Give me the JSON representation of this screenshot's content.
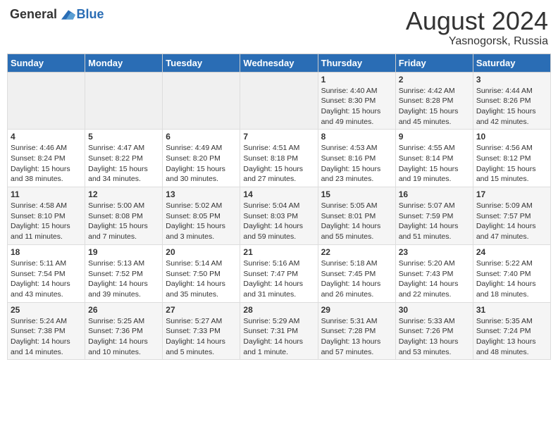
{
  "header": {
    "logo_general": "General",
    "logo_blue": "Blue",
    "month_year": "August 2024",
    "location": "Yasnogorsk, Russia"
  },
  "weekdays": [
    "Sunday",
    "Monday",
    "Tuesday",
    "Wednesday",
    "Thursday",
    "Friday",
    "Saturday"
  ],
  "weeks": [
    [
      {
        "day": "",
        "info": ""
      },
      {
        "day": "",
        "info": ""
      },
      {
        "day": "",
        "info": ""
      },
      {
        "day": "",
        "info": ""
      },
      {
        "day": "1",
        "info": "Sunrise: 4:40 AM\nSunset: 8:30 PM\nDaylight: 15 hours\nand 49 minutes."
      },
      {
        "day": "2",
        "info": "Sunrise: 4:42 AM\nSunset: 8:28 PM\nDaylight: 15 hours\nand 45 minutes."
      },
      {
        "day": "3",
        "info": "Sunrise: 4:44 AM\nSunset: 8:26 PM\nDaylight: 15 hours\nand 42 minutes."
      }
    ],
    [
      {
        "day": "4",
        "info": "Sunrise: 4:46 AM\nSunset: 8:24 PM\nDaylight: 15 hours\nand 38 minutes."
      },
      {
        "day": "5",
        "info": "Sunrise: 4:47 AM\nSunset: 8:22 PM\nDaylight: 15 hours\nand 34 minutes."
      },
      {
        "day": "6",
        "info": "Sunrise: 4:49 AM\nSunset: 8:20 PM\nDaylight: 15 hours\nand 30 minutes."
      },
      {
        "day": "7",
        "info": "Sunrise: 4:51 AM\nSunset: 8:18 PM\nDaylight: 15 hours\nand 27 minutes."
      },
      {
        "day": "8",
        "info": "Sunrise: 4:53 AM\nSunset: 8:16 PM\nDaylight: 15 hours\nand 23 minutes."
      },
      {
        "day": "9",
        "info": "Sunrise: 4:55 AM\nSunset: 8:14 PM\nDaylight: 15 hours\nand 19 minutes."
      },
      {
        "day": "10",
        "info": "Sunrise: 4:56 AM\nSunset: 8:12 PM\nDaylight: 15 hours\nand 15 minutes."
      }
    ],
    [
      {
        "day": "11",
        "info": "Sunrise: 4:58 AM\nSunset: 8:10 PM\nDaylight: 15 hours\nand 11 minutes."
      },
      {
        "day": "12",
        "info": "Sunrise: 5:00 AM\nSunset: 8:08 PM\nDaylight: 15 hours\nand 7 minutes."
      },
      {
        "day": "13",
        "info": "Sunrise: 5:02 AM\nSunset: 8:05 PM\nDaylight: 15 hours\nand 3 minutes."
      },
      {
        "day": "14",
        "info": "Sunrise: 5:04 AM\nSunset: 8:03 PM\nDaylight: 14 hours\nand 59 minutes."
      },
      {
        "day": "15",
        "info": "Sunrise: 5:05 AM\nSunset: 8:01 PM\nDaylight: 14 hours\nand 55 minutes."
      },
      {
        "day": "16",
        "info": "Sunrise: 5:07 AM\nSunset: 7:59 PM\nDaylight: 14 hours\nand 51 minutes."
      },
      {
        "day": "17",
        "info": "Sunrise: 5:09 AM\nSunset: 7:57 PM\nDaylight: 14 hours\nand 47 minutes."
      }
    ],
    [
      {
        "day": "18",
        "info": "Sunrise: 5:11 AM\nSunset: 7:54 PM\nDaylight: 14 hours\nand 43 minutes."
      },
      {
        "day": "19",
        "info": "Sunrise: 5:13 AM\nSunset: 7:52 PM\nDaylight: 14 hours\nand 39 minutes."
      },
      {
        "day": "20",
        "info": "Sunrise: 5:14 AM\nSunset: 7:50 PM\nDaylight: 14 hours\nand 35 minutes."
      },
      {
        "day": "21",
        "info": "Sunrise: 5:16 AM\nSunset: 7:47 PM\nDaylight: 14 hours\nand 31 minutes."
      },
      {
        "day": "22",
        "info": "Sunrise: 5:18 AM\nSunset: 7:45 PM\nDaylight: 14 hours\nand 26 minutes."
      },
      {
        "day": "23",
        "info": "Sunrise: 5:20 AM\nSunset: 7:43 PM\nDaylight: 14 hours\nand 22 minutes."
      },
      {
        "day": "24",
        "info": "Sunrise: 5:22 AM\nSunset: 7:40 PM\nDaylight: 14 hours\nand 18 minutes."
      }
    ],
    [
      {
        "day": "25",
        "info": "Sunrise: 5:24 AM\nSunset: 7:38 PM\nDaylight: 14 hours\nand 14 minutes."
      },
      {
        "day": "26",
        "info": "Sunrise: 5:25 AM\nSunset: 7:36 PM\nDaylight: 14 hours\nand 10 minutes."
      },
      {
        "day": "27",
        "info": "Sunrise: 5:27 AM\nSunset: 7:33 PM\nDaylight: 14 hours\nand 5 minutes."
      },
      {
        "day": "28",
        "info": "Sunrise: 5:29 AM\nSunset: 7:31 PM\nDaylight: 14 hours\nand 1 minute."
      },
      {
        "day": "29",
        "info": "Sunrise: 5:31 AM\nSunset: 7:28 PM\nDaylight: 13 hours\nand 57 minutes."
      },
      {
        "day": "30",
        "info": "Sunrise: 5:33 AM\nSunset: 7:26 PM\nDaylight: 13 hours\nand 53 minutes."
      },
      {
        "day": "31",
        "info": "Sunrise: 5:35 AM\nSunset: 7:24 PM\nDaylight: 13 hours\nand 48 minutes."
      }
    ]
  ]
}
